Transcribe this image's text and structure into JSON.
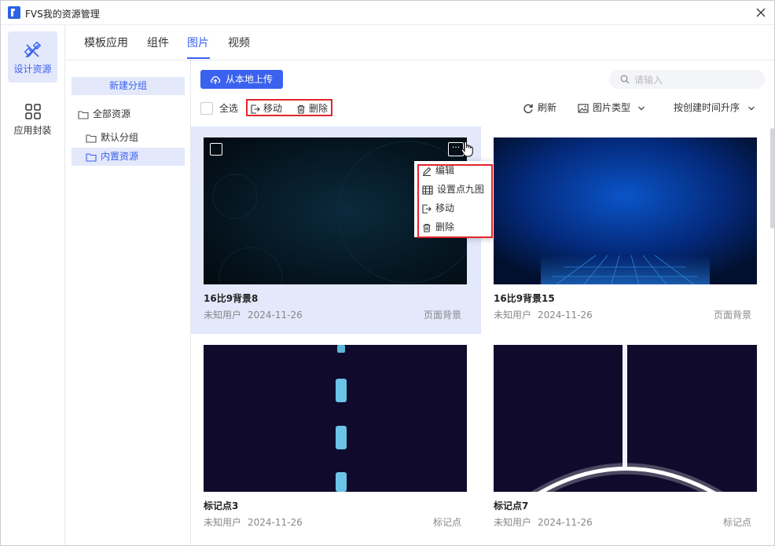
{
  "window": {
    "title": "FVS我的资源管理"
  },
  "sidenav": [
    {
      "label": "设计资源",
      "icon": "design-resources-icon",
      "active": true
    },
    {
      "label": "应用封装",
      "icon": "app-package-icon",
      "active": false
    }
  ],
  "tabs": [
    {
      "label": "模板应用",
      "active": false
    },
    {
      "label": "组件",
      "active": false
    },
    {
      "label": "图片",
      "active": true
    },
    {
      "label": "视频",
      "active": false
    }
  ],
  "groups": {
    "new_group_label": "新建分组",
    "tree": [
      {
        "label": "全部资源",
        "level": 0,
        "active": false
      },
      {
        "label": "默认分组",
        "level": 1,
        "active": false
      },
      {
        "label": "内置资源",
        "level": 1,
        "active": true
      }
    ]
  },
  "toolbar": {
    "upload_label": "从本地上传",
    "search_placeholder": "请输入",
    "select_all_label": "全选",
    "move_label": "移动",
    "delete_label": "删除",
    "refresh_label": "刷新",
    "image_type_label": "图片类型",
    "sort_label": "按创建时间升序"
  },
  "cards": [
    {
      "name": "16比9背景8",
      "user": "未知用户",
      "date": "2024-11-26",
      "type": "页面背景",
      "selected": true
    },
    {
      "name": "16比9背景15",
      "user": "未知用户",
      "date": "2024-11-26",
      "type": "页面背景",
      "selected": false
    },
    {
      "name": "标记点3",
      "user": "未知用户",
      "date": "2024-11-26",
      "type": "标记点",
      "selected": false
    },
    {
      "name": "标记点7",
      "user": "未知用户",
      "date": "2024-11-26",
      "type": "标记点",
      "selected": false
    }
  ],
  "context_menu": [
    {
      "label": "编辑",
      "icon": "edit-icon"
    },
    {
      "label": "设置点九图",
      "icon": "nine-patch-icon"
    },
    {
      "label": "移动",
      "icon": "move-icon"
    },
    {
      "label": "删除",
      "icon": "trash-icon"
    }
  ],
  "colors": {
    "accent": "#3a62ee",
    "accent_light": "#e3e8fb",
    "highlight_red": "#e0262b"
  }
}
